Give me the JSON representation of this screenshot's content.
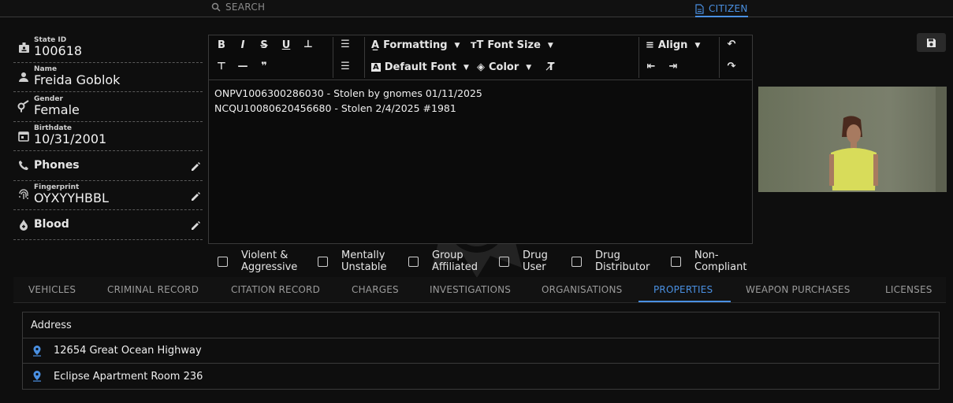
{
  "topbar": {
    "search_label": "SEARCH",
    "citizen_label": "CITIZEN"
  },
  "info": {
    "state_id": {
      "label": "State ID",
      "value": "100618"
    },
    "name": {
      "label": "Name",
      "value": "Freida Goblok"
    },
    "gender": {
      "label": "Gender",
      "value": "Female"
    },
    "birthdate": {
      "label": "Birthdate",
      "value": "10/31/2001"
    },
    "phones": {
      "label": "Phones"
    },
    "fingerprint": {
      "label": "Fingerprint",
      "value": "OYXYYHBBL"
    },
    "blood": {
      "label": "Blood"
    }
  },
  "toolbar": {
    "formatting": "Formatting",
    "font_size": "Font Size",
    "align": "Align",
    "default_font": "Default Font",
    "color": "Color"
  },
  "notes": [
    "ONPV1006300286030 - Stolen by gnomes 01/11/2025",
    "NCQU10080620456680 - Stolen 2/4/2025 #1981"
  ],
  "flags": [
    {
      "l1": "Violent &",
      "l2": "Aggressive"
    },
    {
      "l1": "Mentally",
      "l2": "Unstable"
    },
    {
      "l1": "Group",
      "l2": "Affiliated"
    },
    {
      "l1": "Drug",
      "l2": "User"
    },
    {
      "l1": "Drug",
      "l2": "Distributor"
    },
    {
      "l1": "Non-",
      "l2": "Compliant"
    }
  ],
  "tabs": [
    "VEHICLES",
    "CRIMINAL RECORD",
    "CITATION RECORD",
    "CHARGES",
    "INVESTIGATIONS",
    "ORGANISATIONS",
    "PROPERTIES",
    "WEAPON PURCHASES",
    "LICENSES"
  ],
  "active_tab": "PROPERTIES",
  "properties": {
    "header": "Address",
    "rows": [
      "12654 Great Ocean Highway",
      "Eclipse Apartment Room 236"
    ]
  },
  "colors": {
    "accent": "#4a90e2",
    "background": "#0e0e0e"
  }
}
